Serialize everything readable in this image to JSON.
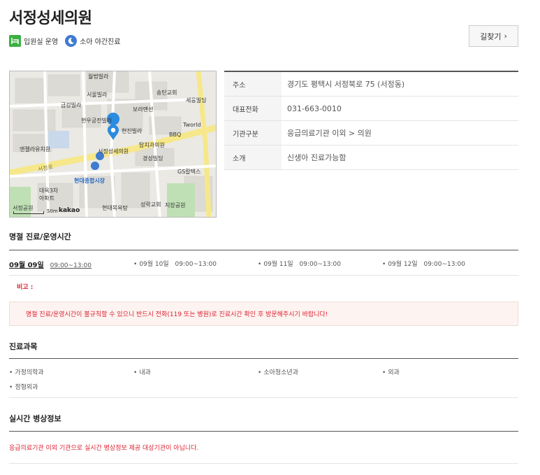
{
  "header": {
    "title": "서정성세의원",
    "badges": [
      {
        "icon": "bed-icon",
        "label": "입원실 운영"
      },
      {
        "icon": "moon-icon",
        "label": "소아 야간진료"
      }
    ],
    "directions_label": "길찾기",
    "directions_arrow": "›"
  },
  "map": {
    "labels": [
      {
        "text": "월법빌라",
        "style": "normal"
      },
      {
        "text": "서울빌라",
        "style": "normal"
      },
      {
        "text": "송탄교회",
        "style": "normal"
      },
      {
        "text": "금강빌라",
        "style": "normal"
      },
      {
        "text": "보라맨션",
        "style": "normal"
      },
      {
        "text": "세웅빌딩",
        "style": "normal"
      },
      {
        "text": "현우궁전빌라",
        "style": "normal"
      },
      {
        "text": "현진빌라",
        "style": "normal"
      },
      {
        "text": "Tworld",
        "style": "normal"
      },
      {
        "text": "BBQ",
        "style": "normal"
      },
      {
        "text": "엔젤라유치원",
        "style": "normal"
      },
      {
        "text": "탑치과의원",
        "style": "normal"
      },
      {
        "text": "서정성세의원",
        "style": "normal"
      },
      {
        "text": "경성빌딩",
        "style": "normal"
      },
      {
        "text": "GS칼텍스",
        "style": "normal"
      },
      {
        "text": "현대종합시장",
        "style": "blue"
      },
      {
        "text": "대옥3차",
        "style": "normal"
      },
      {
        "text": "아파트",
        "style": "normal"
      },
      {
        "text": "현대목욕탕",
        "style": "normal"
      },
      {
        "text": "성락교회",
        "style": "normal"
      },
      {
        "text": "지장공원",
        "style": "normal"
      },
      {
        "text": "서정공원",
        "style": "normal"
      },
      {
        "text": "서정로",
        "style": "normal"
      }
    ],
    "scale_label": "50m",
    "provider": "kakao"
  },
  "info": [
    {
      "key": "주소",
      "value": "경기도 평택시 서정북로 75 (서정동)"
    },
    {
      "key": "대표전화",
      "value": "031-663-0010"
    },
    {
      "key": "기관구분",
      "value": "응급의료기관 이외 > 의원"
    },
    {
      "key": "소개",
      "value": "신생아 진료가능함"
    }
  ],
  "holiday": {
    "title": "명절 진료/운영시간",
    "days": [
      {
        "date": "09월 09일",
        "time": "09:00~13:00",
        "selected": true
      },
      {
        "date": "09월 10일",
        "time": "09:00~13:00",
        "selected": false
      },
      {
        "date": "09월 11일",
        "time": "09:00~13:00",
        "selected": false
      },
      {
        "date": "09월 12일",
        "time": "09:00~13:00",
        "selected": false
      }
    ],
    "note_label": "비고 :",
    "alert": "명절 진료/운영시간이 불규칙할 수 있으니 반드시 전화(119 또는 병원)로 진료시간 확인 후 방문해주시기 바랍니다!"
  },
  "subjects": {
    "title": "진료과목",
    "items": [
      "가정의학과",
      "내과",
      "소아청소년과",
      "외과",
      "정형외과"
    ]
  },
  "beds": {
    "title": "실시간 병상정보",
    "notice": "응급의료기관 이외 기관으로 실시간 병상정보 제공 대상기관이 아닙니다."
  },
  "colors": {
    "accent_red": "#dd2233",
    "badge_green": "#3cb043",
    "badge_blue": "#3f7bd0",
    "road_yellow": "#f6e88a",
    "marker_blue": "#2b8be0"
  }
}
